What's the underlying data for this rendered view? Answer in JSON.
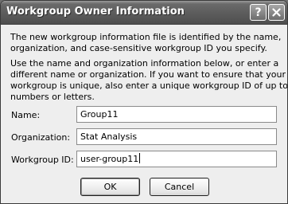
{
  "window": {
    "title": "Workgroup Owner Information",
    "help_glyph": "?",
    "close_icon": "close-icon"
  },
  "intro": {
    "lines": [
      "The new workgroup information file is identified by the name,",
      "organization, and case-sensitive workgroup ID you specify."
    ]
  },
  "instructions": {
    "lines": [
      "Use the name and organization information below, or enter a",
      "different name or organization. If you want to ensure that your",
      "workgroup is unique, also enter a unique workgroup ID of up to 20",
      "numbers or letters."
    ]
  },
  "fields": {
    "name": {
      "label": "Name:",
      "value": "Group11"
    },
    "organization": {
      "label": "Organization:",
      "value": "Stat Analysis"
    },
    "workgroup_id": {
      "label": "Workgroup ID:",
      "value": "user-group11"
    }
  },
  "buttons": {
    "ok": "OK",
    "cancel": "Cancel"
  }
}
